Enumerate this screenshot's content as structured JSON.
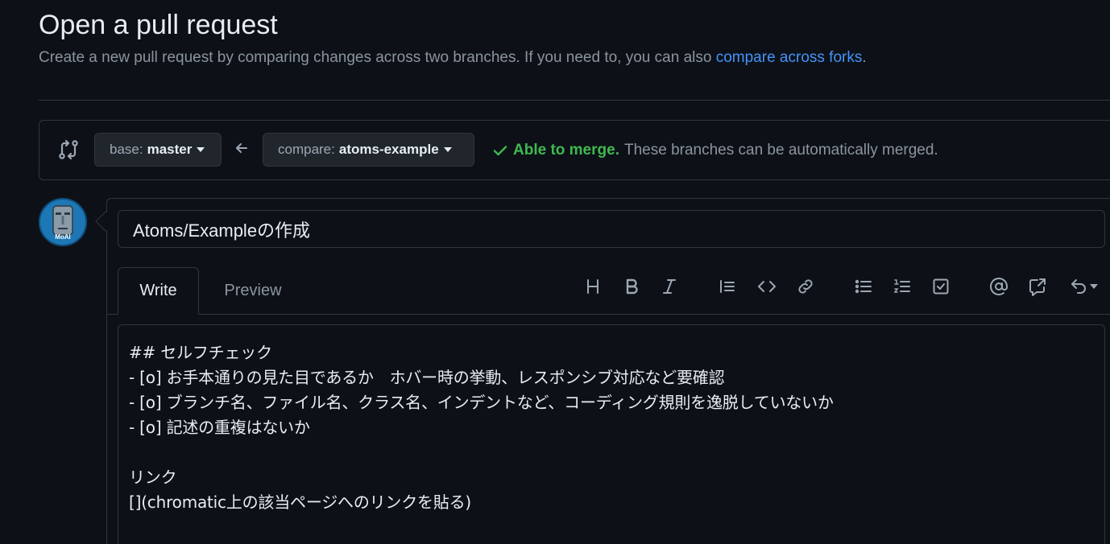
{
  "header": {
    "title": "Open a pull request",
    "subtitle_prefix": "Create a new pull request by comparing changes across two branches. If you need to, you can also ",
    "subtitle_link": "compare across forks",
    "subtitle_suffix": "."
  },
  "range": {
    "base_prefix": "base:",
    "base_branch": "master",
    "compare_prefix": "compare:",
    "compare_branch": "atoms-example",
    "merge_status": "Able to merge.",
    "merge_detail": "These branches can be automatically merged."
  },
  "avatar": {
    "label": "MoAI"
  },
  "form": {
    "title_value": "Atoms/Exampleの作成",
    "tabs": [
      "Write",
      "Preview"
    ],
    "toolbar_icons": [
      "heading-icon",
      "bold-icon",
      "italic-icon",
      "quote-icon",
      "code-icon",
      "link-icon",
      "unordered-list-icon",
      "ordered-list-icon",
      "task-list-icon",
      "mention-icon",
      "cross-reference-icon",
      "saved-reply-icon"
    ],
    "body_lines": [
      "## セルフチェック",
      "- [o] お手本通りの見た目であるか　ホバー時の挙動、レスポンシブ対応など要確認",
      "- [o] ブランチ名、ファイル名、クラス名、インデントなど、コーディング規則を逸脱していないか",
      "- [o] 記述の重複はないか",
      "",
      "リンク",
      "[](chromatic上の該当ページへのリンクを貼る)"
    ]
  },
  "colors": {
    "background": "#0d1117",
    "border": "#30363d",
    "link": "#4493f8",
    "success": "#3fb950",
    "muted": "#8b949e"
  }
}
